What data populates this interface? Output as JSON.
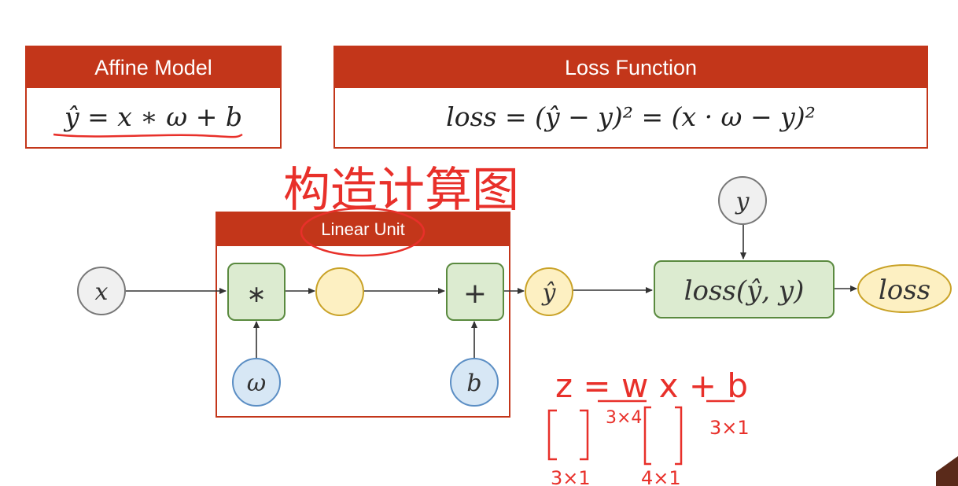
{
  "affine_panel": {
    "title": "Affine Model",
    "formula": "ŷ = x ∗ ω + b"
  },
  "loss_panel": {
    "title": "Loss Function",
    "formula": "loss = (ŷ − y)² = (x · ω − y)²"
  },
  "linear_unit": {
    "title": "Linear Unit"
  },
  "nodes": {
    "x": "x",
    "multiply": "∗",
    "intermediate": "",
    "add": "+",
    "omega": "ω",
    "b": "b",
    "yhat": "ŷ",
    "y": "y",
    "loss_fn": "loss(ŷ, y)",
    "loss_out": "loss"
  },
  "annotations": {
    "chinese_note": "构造计算图",
    "equation": "z = w x + b",
    "dim_w": "3×4",
    "dim_b": "3×1",
    "dim_z": "3×1",
    "dim_x": "4×1"
  },
  "colors": {
    "header_red": "#c3361a",
    "green_fill": "#dcebd0",
    "green_stroke": "#5a8a3f",
    "yellow_fill": "#fdf0c2",
    "yellow_stroke": "#c9a227",
    "blue_fill": "#d7e7f5",
    "blue_stroke": "#5b8ec4",
    "grey_fill": "#f0f0f0",
    "grey_stroke": "#777777",
    "ink_red": "#e8302a"
  }
}
